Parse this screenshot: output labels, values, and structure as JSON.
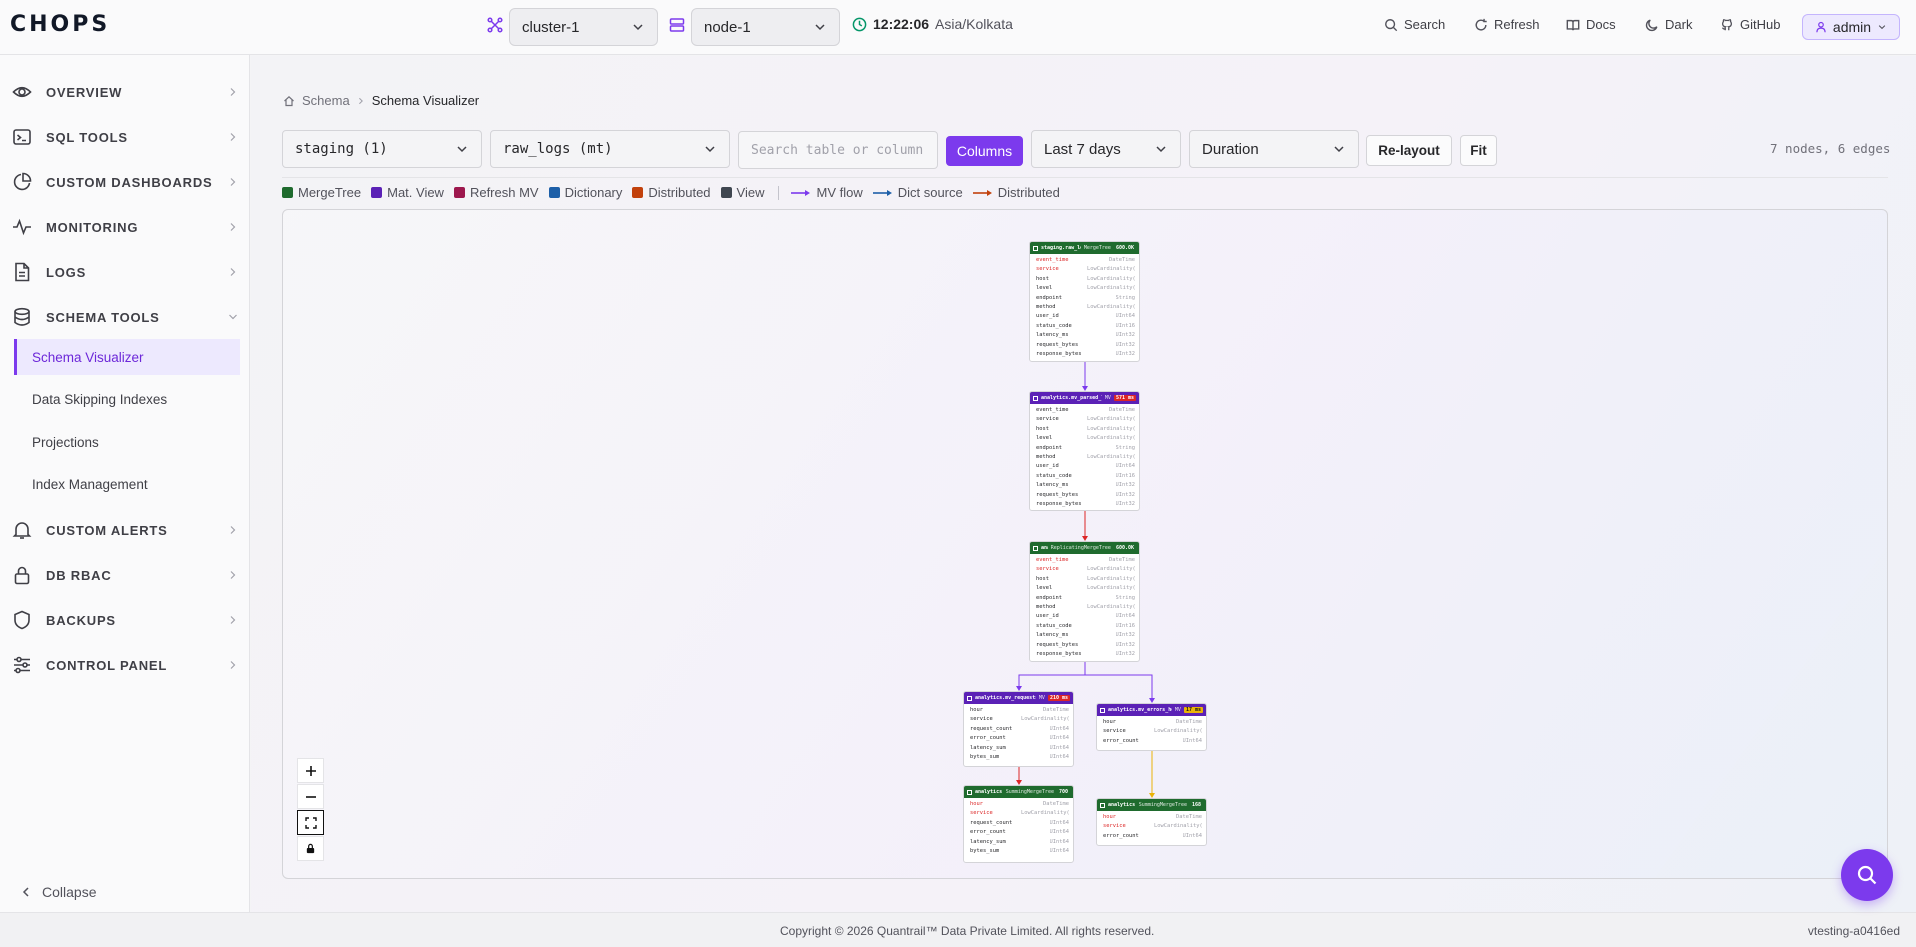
{
  "header": {
    "logo": "CHOPS",
    "cluster_select": "cluster-1",
    "node_select": "node-1",
    "time": "12:22:06",
    "timezone": "Asia/Kolkata",
    "links": {
      "search": "Search",
      "refresh": "Refresh",
      "docs": "Docs",
      "dark": "Dark",
      "github": "GitHub"
    },
    "user": "admin"
  },
  "sidebar": {
    "items": [
      {
        "label": "OVERVIEW",
        "icon": "eye-icon"
      },
      {
        "label": "SQL TOOLS",
        "icon": "terminal-icon"
      },
      {
        "label": "CUSTOM DASHBOARDS",
        "icon": "pie-chart-icon"
      },
      {
        "label": "MONITORING",
        "icon": "activity-icon"
      },
      {
        "label": "LOGS",
        "icon": "file-text-icon"
      },
      {
        "label": "SCHEMA TOOLS",
        "icon": "database-icon"
      },
      {
        "label": "CUSTOM ALERTS",
        "icon": "bell-icon"
      },
      {
        "label": "DB RBAC",
        "icon": "lock-icon"
      },
      {
        "label": "BACKUPS",
        "icon": "shield-icon"
      },
      {
        "label": "CONTROL PANEL",
        "icon": "sliders-icon"
      }
    ],
    "schema_sub": [
      "Schema Visualizer",
      "Data Skipping Indexes",
      "Projections",
      "Index Management"
    ],
    "collapse": "Collapse"
  },
  "breadcrumb": {
    "root": "Schema",
    "current": "Schema Visualizer"
  },
  "toolbar": {
    "database_select": "staging (1)",
    "table_select": "raw_logs (mt)",
    "search_placeholder": "Search table or column",
    "columns_button": "Columns",
    "range_select": "Last 7 days",
    "metric_select": "Duration",
    "relayout_button": "Re-layout",
    "fit_button": "Fit",
    "stats": "7 nodes, 6 edges"
  },
  "legend": {
    "types": [
      {
        "label": "MergeTree",
        "color": "#1f6b2e"
      },
      {
        "label": "Mat. View",
        "color": "#5b21b6"
      },
      {
        "label": "Refresh MV",
        "color": "#9d174d"
      },
      {
        "label": "Dictionary",
        "color": "#1d5fa8"
      },
      {
        "label": "Distributed",
        "color": "#c2410c"
      },
      {
        "label": "View",
        "color": "#3f4650"
      }
    ],
    "edges": [
      {
        "label": "MV flow",
        "color": "#7c3aed"
      },
      {
        "label": "Dict source",
        "color": "#1d5fa8"
      },
      {
        "label": "Distributed",
        "color": "#c2410c"
      }
    ]
  },
  "nodes": [
    {
      "name": "staging.raw_logs",
      "engine": "MergeTree",
      "badge": "600.0K",
      "kind": "mt",
      "cols": [
        [
          "event_time",
          "DateTime",
          1
        ],
        [
          "service",
          "LowCardinality(String)",
          1
        ],
        [
          "host",
          "LowCardinality(String)",
          0
        ],
        [
          "level",
          "LowCardinality(String)",
          0
        ],
        [
          "endpoint",
          "String",
          0
        ],
        [
          "method",
          "LowCardinality(String)",
          0
        ],
        [
          "user_id",
          "UInt64",
          0
        ],
        [
          "status_code",
          "UInt16",
          0
        ],
        [
          "latency_ms",
          "UInt32",
          0
        ],
        [
          "request_bytes",
          "UInt32",
          0
        ],
        [
          "response_bytes",
          "UInt32",
          0
        ]
      ]
    },
    {
      "name": "analytics.mv_parsed_logs",
      "engine": "MV",
      "badge": "571 ms",
      "kind": "mv",
      "badge_color": "#dc2626",
      "cols": [
        [
          "event_time",
          "DateTime",
          0
        ],
        [
          "service",
          "LowCardinality(String)",
          0
        ],
        [
          "host",
          "LowCardinality(String)",
          0
        ],
        [
          "level",
          "LowCardinality(String)",
          0
        ],
        [
          "endpoint",
          "String",
          0
        ],
        [
          "method",
          "LowCardinality(String)",
          0
        ],
        [
          "user_id",
          "UInt64",
          0
        ],
        [
          "status_code",
          "UInt16",
          0
        ],
        [
          "latency_ms",
          "UInt32",
          0
        ],
        [
          "request_bytes",
          "UInt32",
          0
        ],
        [
          "response_bytes",
          "UInt32",
          0
        ]
      ]
    },
    {
      "name": "analytics.parsed_logs",
      "engine": "ReplicatingMergeTree",
      "badge": "600.0K",
      "kind": "mt",
      "cols": [
        [
          "event_time",
          "DateTime",
          1
        ],
        [
          "service",
          "LowCardinality(String)",
          1
        ],
        [
          "host",
          "LowCardinality(String)",
          0
        ],
        [
          "level",
          "LowCardinality(String)",
          0
        ],
        [
          "endpoint",
          "String",
          0
        ],
        [
          "method",
          "LowCardinality(String)",
          0
        ],
        [
          "user_id",
          "UInt64",
          0
        ],
        [
          "status_code",
          "UInt16",
          0
        ],
        [
          "latency_ms",
          "UInt32",
          0
        ],
        [
          "request_bytes",
          "UInt32",
          0
        ],
        [
          "response_bytes",
          "UInt32",
          0
        ]
      ]
    },
    {
      "name": "analytics.mv_requests_hourly",
      "engine": "MV",
      "badge": "210 ms",
      "kind": "mv",
      "badge_color": "#dc2626",
      "cols": [
        [
          "hour",
          "DateTime",
          0
        ],
        [
          "service",
          "LowCardinality(String)",
          0
        ],
        [
          "request_count",
          "UInt64",
          0
        ],
        [
          "error_count",
          "UInt64",
          0
        ],
        [
          "latency_sum",
          "UInt64",
          0
        ],
        [
          "bytes_sum",
          "UInt64",
          0
        ]
      ]
    },
    {
      "name": "analytics.mv_errors_hourly",
      "engine": "MV",
      "badge": "17 ms",
      "kind": "mv",
      "badge_color": "#eab308",
      "cols": [
        [
          "hour",
          "DateTime",
          0
        ],
        [
          "service",
          "LowCardinality(String)",
          0
        ],
        [
          "error_count",
          "UInt64",
          0
        ]
      ]
    },
    {
      "name": "analytics.requests_hourly",
      "engine": "SummingMergeTree",
      "badge": "700",
      "kind": "mt",
      "cols": [
        [
          "hour",
          "DateTime",
          1
        ],
        [
          "service",
          "LowCardinality(String)",
          1
        ],
        [
          "request_count",
          "UInt64",
          0
        ],
        [
          "error_count",
          "UInt64",
          0
        ],
        [
          "latency_sum",
          "UInt64",
          0
        ],
        [
          "bytes_sum",
          "UInt64",
          0
        ]
      ]
    },
    {
      "name": "analytics.errors_hourly",
      "engine": "SummingMergeTree",
      "badge": "168",
      "kind": "mt",
      "cols": [
        [
          "hour",
          "DateTime",
          1
        ],
        [
          "service",
          "LowCardinality(String)",
          1
        ],
        [
          "error_count",
          "UInt64",
          0
        ]
      ]
    }
  ],
  "footer": {
    "copyright": "Copyright © 2026 Quantrail™ Data Private Limited. All rights reserved.",
    "build": "vtesting-a0416ed"
  }
}
